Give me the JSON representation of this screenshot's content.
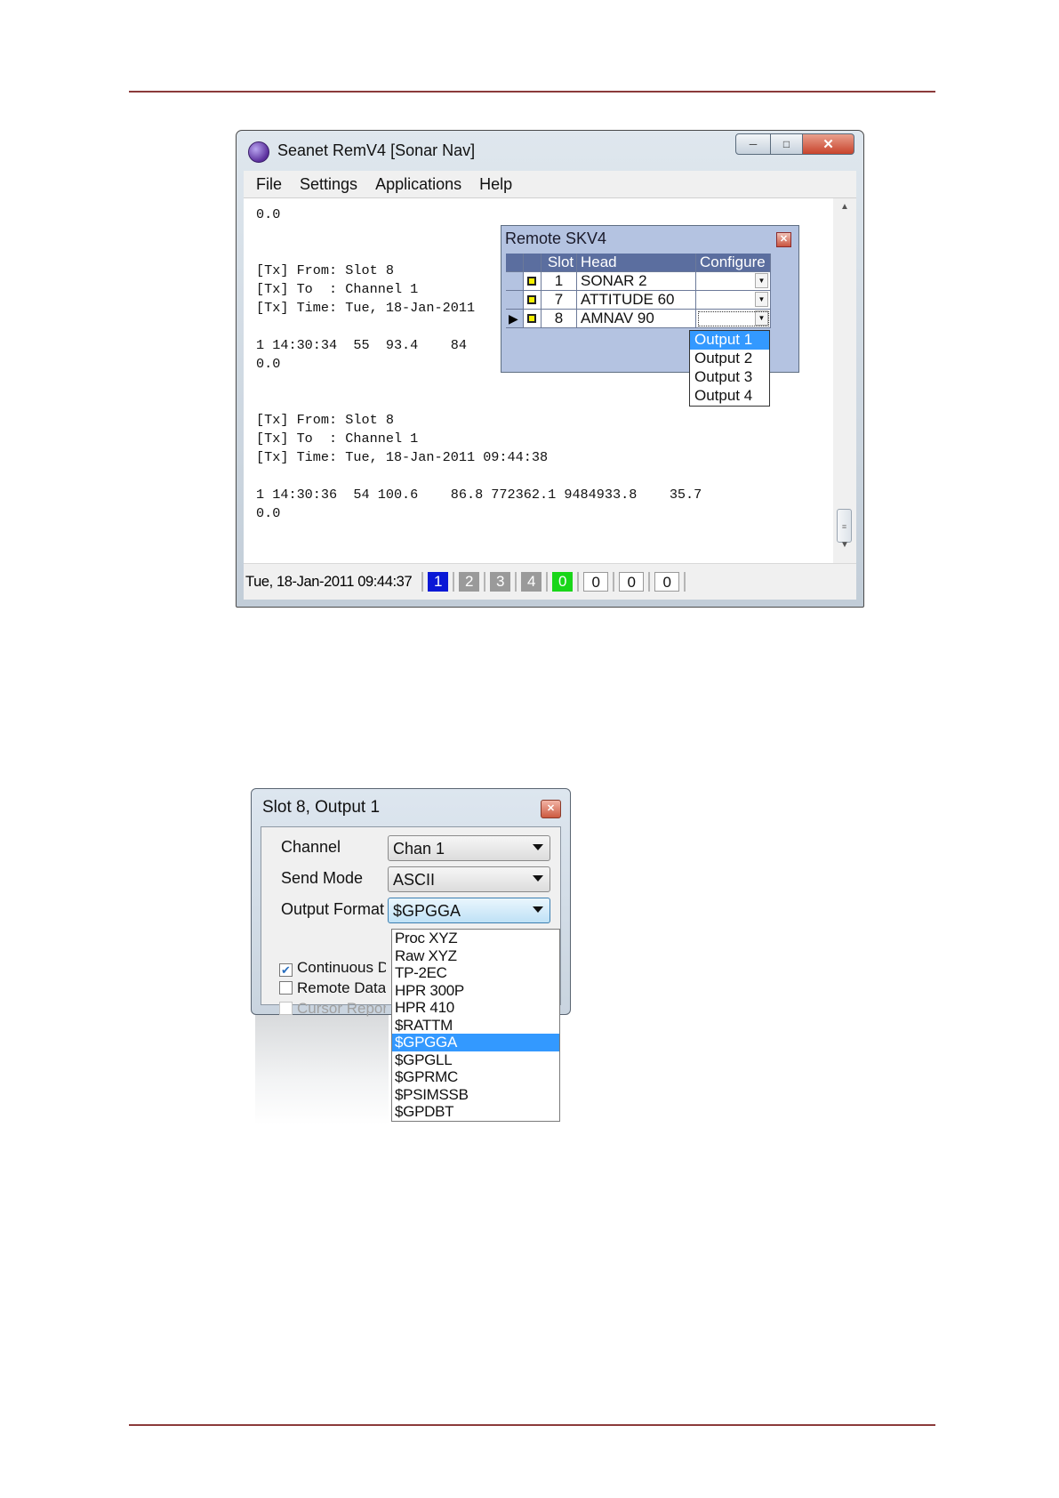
{
  "main_window": {
    "title": "Seanet RemV4 [Sonar Nav]",
    "menu": [
      "File",
      "Settings",
      "Applications",
      "Help"
    ],
    "console_lines": [
      "0.0",
      "",
      "",
      "[Tx] From: Slot 8",
      "[Tx] To  : Channel 1",
      "[Tx] Time: Tue, 18-Jan-2011",
      "",
      "1 14:30:34  55  93.4    84",
      "0.0",
      "",
      "",
      "[Tx] From: Slot 8",
      "[Tx] To  : Channel 1",
      "[Tx] Time: Tue, 18-Jan-2011 09:44:38",
      "",
      "1 14:30:36  54 100.6    86.8 772362.1 9484933.8    35.7",
      "0.0"
    ],
    "status": {
      "time": "Tue, 18-Jan-2011 09:44:37",
      "indicators": [
        {
          "label": "1",
          "color": "#0a18d6",
          "boxed": false
        },
        {
          "label": "2",
          "color": "#9a9a9a",
          "boxed": false
        },
        {
          "label": "3",
          "color": "#9a9a9a",
          "boxed": false
        },
        {
          "label": "4",
          "color": "#9a9a9a",
          "boxed": false
        },
        {
          "label": "0",
          "color": "#19d619",
          "boxed": false
        },
        {
          "label": "0",
          "color": "#ffffff",
          "boxed": true
        },
        {
          "label": "0",
          "color": "#ffffff",
          "boxed": true
        },
        {
          "label": "0",
          "color": "#ffffff",
          "boxed": true
        }
      ]
    }
  },
  "remote_skv4": {
    "title": "Remote SKV4",
    "columns": {
      "slot": "Slot",
      "head": "Head",
      "configure": "Configure"
    },
    "rows": [
      {
        "slot": "1",
        "head": "SONAR 2",
        "current": false
      },
      {
        "slot": "7",
        "head": "ATTITUDE 60",
        "current": false
      },
      {
        "slot": "8",
        "head": "AMNAV 90",
        "current": true
      }
    ],
    "configure_options": [
      "Output 1",
      "Output 2",
      "Output 3",
      "Output 4"
    ],
    "configure_selected": "Output 1"
  },
  "slot_dialog": {
    "title": "Slot 8, Output 1",
    "fields": {
      "channel_label": "Channel",
      "channel_value": "Chan 1",
      "send_mode_label": "Send Mode",
      "send_mode_value": "ASCII",
      "output_format_label": "Output Format",
      "output_format_value": "$GPGGA"
    },
    "checkboxes": [
      {
        "label": "Continuous Data",
        "checked": true,
        "disabled": false
      },
      {
        "label": "Remote Data",
        "checked": false,
        "disabled": false
      },
      {
        "label": "Cursor Report",
        "checked": false,
        "disabled": true
      }
    ],
    "output_format_options": [
      "Proc XYZ",
      "Raw XYZ",
      "TP-2EC",
      "HPR 300P",
      "HPR 410",
      "$RATTM",
      "$GPGGA",
      "$GPGLL",
      "$GPRMC",
      "$PSIMSSB",
      "$GPDBT"
    ],
    "output_format_selected": "$GPGGA"
  }
}
